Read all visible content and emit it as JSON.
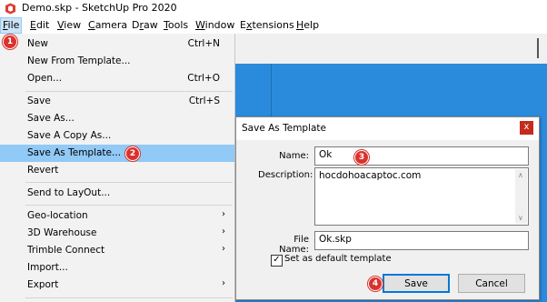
{
  "window": {
    "title": "Demo.skp - SketchUp Pro 2020"
  },
  "menubar": {
    "items": [
      {
        "label": "File",
        "u": "F"
      },
      {
        "label": "Edit",
        "u": "E"
      },
      {
        "label": "View",
        "u": "V"
      },
      {
        "label": "Camera",
        "u": "C"
      },
      {
        "label": "Draw",
        "u": "r"
      },
      {
        "label": "Tools",
        "u": "T"
      },
      {
        "label": "Window",
        "u": "W"
      },
      {
        "label": "Extensions",
        "u": "x"
      },
      {
        "label": "Help",
        "u": "H"
      }
    ]
  },
  "file_menu": {
    "items": [
      {
        "label": "New",
        "shortcut": "Ctrl+N"
      },
      {
        "label": "New From Template...",
        "shortcut": ""
      },
      {
        "label": "Open...",
        "shortcut": "Ctrl+O"
      },
      {
        "label": "Save",
        "shortcut": "Ctrl+S"
      },
      {
        "label": "Save As...",
        "shortcut": ""
      },
      {
        "label": "Save A Copy As...",
        "shortcut": ""
      },
      {
        "label": "Save As Template...",
        "shortcut": ""
      },
      {
        "label": "Revert",
        "shortcut": ""
      },
      {
        "label": "Send to LayOut...",
        "shortcut": ""
      },
      {
        "label": "Geo-location",
        "submenu": true
      },
      {
        "label": "3D Warehouse",
        "submenu": true
      },
      {
        "label": "Trimble Connect",
        "submenu": true
      },
      {
        "label": "Import...",
        "shortcut": ""
      },
      {
        "label": "Export",
        "submenu": true
      }
    ],
    "highlighted": "Save As Template..."
  },
  "dialog": {
    "title": "Save As Template",
    "close_glyph": "x",
    "name_label": "Name:",
    "name_value": "Ok",
    "description_label": "Description:",
    "description_value": "hocdohoacaptoc.com",
    "filename_label": "File Name:",
    "filename_value": "Ok.skp",
    "default_checkbox_label": "Set as default template",
    "default_checked": true,
    "save_label": "Save",
    "cancel_label": "Cancel"
  },
  "steps": [
    "1",
    "2",
    "3",
    "4"
  ],
  "colors": {
    "highlight": "#91c9f7",
    "viewport": "#2a8bdc",
    "badge": "#d9322d",
    "close": "#c42b1c"
  }
}
